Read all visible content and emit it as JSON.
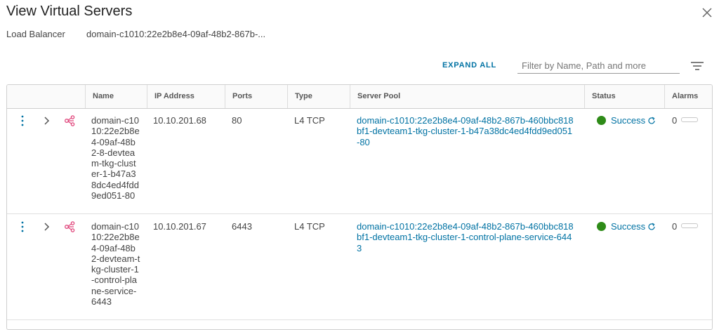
{
  "dialog": {
    "title": "View Virtual Servers",
    "load_balancer_label": "Load Balancer",
    "load_balancer_value": "domain-c1010:22e2b8e4-09af-48b2-867b-..."
  },
  "toolbar": {
    "expand_all": "EXPAND ALL",
    "filter_placeholder": "Filter by Name, Path and more",
    "filter_value": ""
  },
  "table": {
    "columns": [
      "Name",
      "IP Address",
      "Ports",
      "Type",
      "Server Pool",
      "Status",
      "Alarms"
    ],
    "rows": [
      {
        "name": "domain-c1010:22e2b8e4-09af-48b2-8-devteam-tkg-cluster-1-b47a38dc4ed4fdd9ed051-80",
        "ip": "10.10.201.68",
        "ports": "80",
        "type": "L4 TCP",
        "server_pool": "domain-c1010:22e2b8e4-09af-48b2-867b-460bbc818bf1-devteam1-tkg-cluster-1-b47a38dc4ed4fdd9ed051-80",
        "status": "Success",
        "alarms": "0"
      },
      {
        "name": "domain-c1010:22e2b8e4-09af-48b2-devteam-tkg-cluster-1-control-plane-service-6443",
        "ip": "10.10.201.67",
        "ports": "6443",
        "type": "L4 TCP",
        "server_pool": "domain-c1010:22e2b8e4-09af-48b2-867b-460bbc818bf1-devteam1-tkg-cluster-1-control-plane-service-6443",
        "status": "Success",
        "alarms": "0"
      }
    ]
  },
  "colors": {
    "link": "#0072a3",
    "success": "#2e8b18",
    "virtual_server_icon": "#e0457b"
  },
  "icons": [
    "close-icon",
    "filter-icon",
    "kebab-menu-icon",
    "chevron-right-icon",
    "virtual-server-icon",
    "refresh-icon"
  ]
}
